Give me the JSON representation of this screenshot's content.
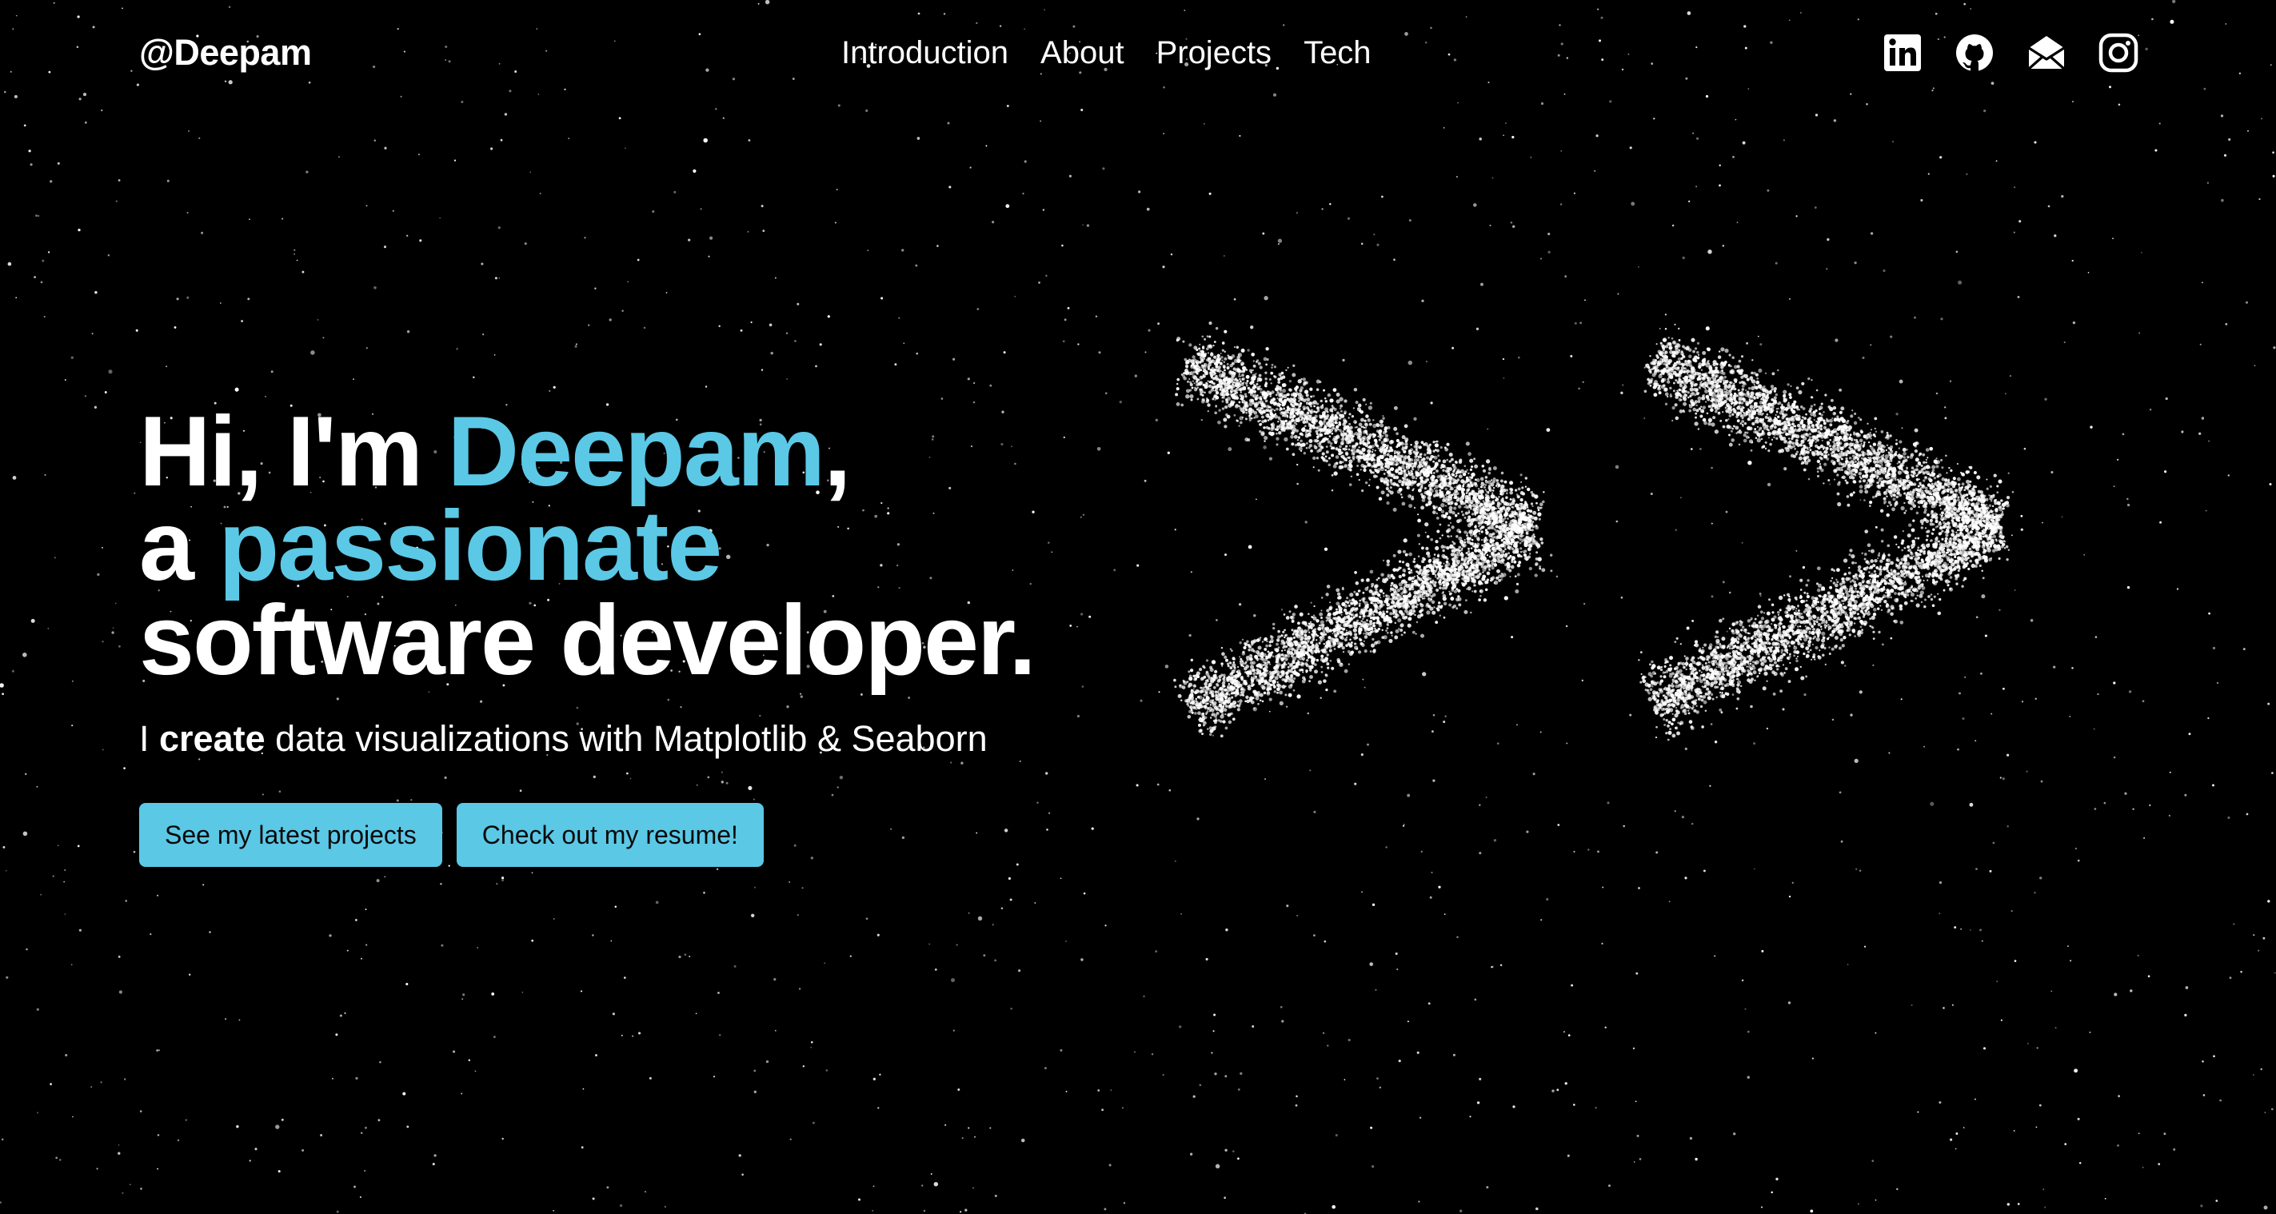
{
  "header": {
    "logo": "@Deepam",
    "nav": [
      {
        "label": "Introduction"
      },
      {
        "label": "About"
      },
      {
        "label": "Projects"
      },
      {
        "label": "Tech"
      }
    ],
    "social_icons": [
      "linkedin-icon",
      "github-icon",
      "mail-icon",
      "instagram-icon"
    ]
  },
  "hero": {
    "line1_prefix": "Hi, I'm ",
    "line1_accent": "Deepam",
    "line1_suffix": ",",
    "line2_prefix": "a ",
    "line2_accent": "passionate",
    "line3": "software developer.",
    "tagline_prefix": "I ",
    "tagline_bold": "create",
    "tagline_suffix": " data visualizations with Matplotlib & Seaborn",
    "buttons": [
      {
        "label": "See my latest projects"
      },
      {
        "label": "Check out my resume!"
      }
    ]
  },
  "graphic": {
    "symbol": ">>",
    "icon": "double-chevron-particle-icon"
  },
  "colors": {
    "background": "#000000",
    "text": "#ffffff",
    "accent": "#5bc8e6",
    "button_text": "#0a0a0a"
  }
}
